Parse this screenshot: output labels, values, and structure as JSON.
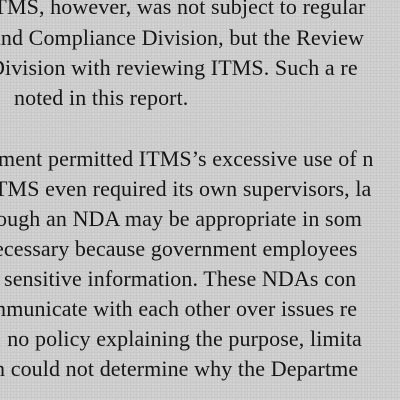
{
  "document": {
    "paragraph_1": {
      "lines": [
        "ITMS, however, was not subject to regular",
        "and Compliance Division, but the Review",
        "Division with reviewing ITMS. Such a re",
        "noted in this report."
      ]
    },
    "paragraph_2": {
      "lines": [
        "ment permitted ITMS’s excessive use of n",
        "TMS even required its own supervisors, la",
        "ough an NDA may be appropriate in som",
        "ecessary because government employees",
        "f sensitive information. These NDAs con",
        "mmunicate with each other over issues re",
        ", no policy explaining the purpose, limita",
        "n could not determine why the Departme"
      ]
    }
  }
}
